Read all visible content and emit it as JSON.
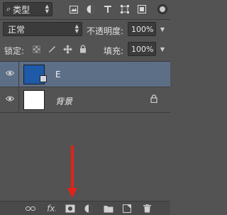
{
  "filter": {
    "kind_label": "类型",
    "icons": [
      "image-filter-icon",
      "adjustment-filter-icon",
      "type-filter-icon",
      "shape-filter-icon",
      "smart-object-filter-icon"
    ]
  },
  "blend": {
    "mode_label": "正常",
    "opacity_label": "不透明度:",
    "opacity_value": "100%"
  },
  "lock": {
    "label": "锁定:",
    "icons": [
      "lock-transparent-pixels-icon",
      "lock-image-pixels-icon",
      "lock-position-icon",
      "lock-all-icon"
    ],
    "fill_label": "填充:",
    "fill_value": "100%"
  },
  "layers": [
    {
      "name": "E",
      "selected": true,
      "thumbnail": "blue",
      "locked": false
    },
    {
      "name": "背景",
      "selected": false,
      "thumbnail": "white",
      "locked": true
    }
  ],
  "bottom_toolbar": {
    "icons": [
      "link-layers-icon",
      "fx-icon",
      "add-mask-icon",
      "adjustment-layer-icon",
      "group-folder-icon",
      "new-layer-icon",
      "trash-icon"
    ],
    "fx_label": "fx"
  },
  "colors": {
    "panel": "#535353",
    "selected_row": "#5d6e87",
    "arrow": "#e32218"
  }
}
